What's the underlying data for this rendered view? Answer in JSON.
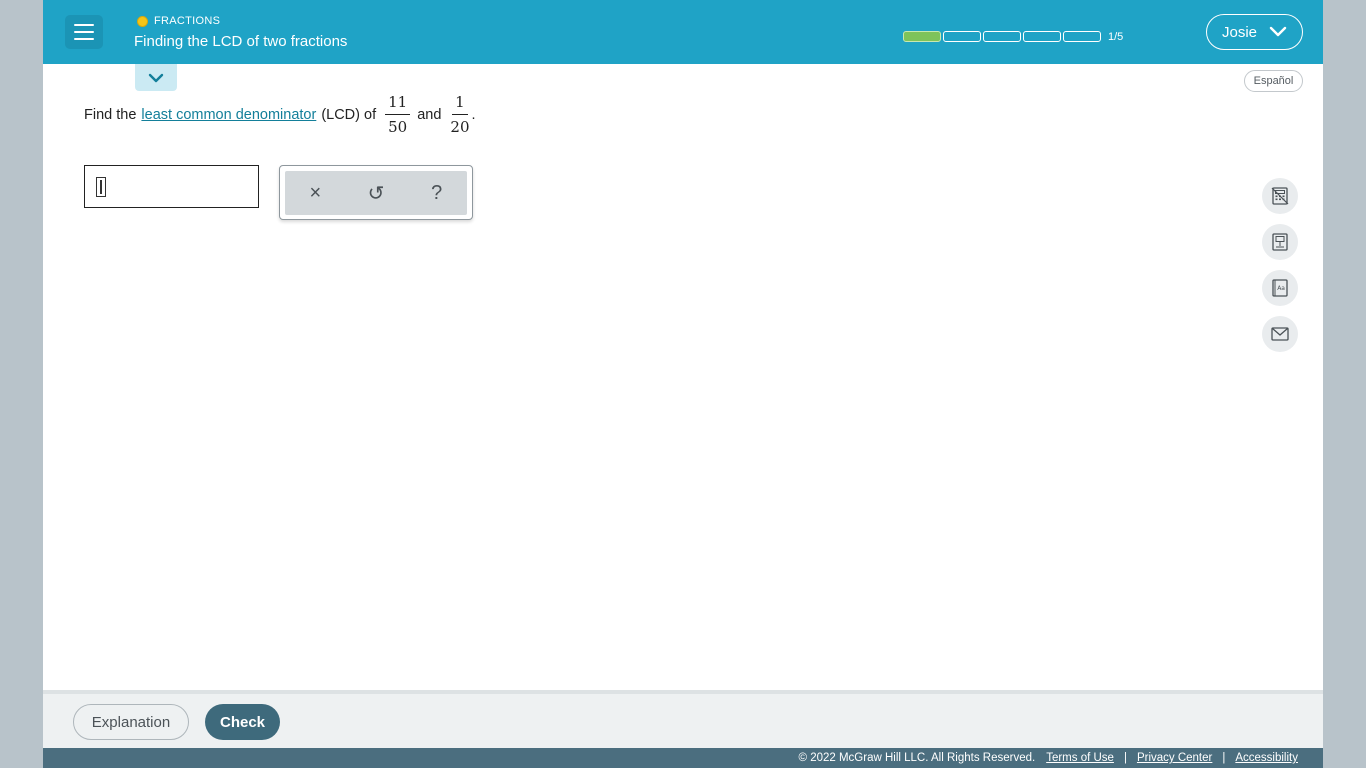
{
  "header": {
    "topic": "FRACTIONS",
    "title": "Finding the LCD of two fractions",
    "progress": {
      "current": 1,
      "total": 5,
      "label": "1/5"
    },
    "user_name": "Josie",
    "menu_icon": "hamburger-icon",
    "user_icon": "chevron-down-icon"
  },
  "language_button": "Español",
  "question": {
    "prefix": "Find the",
    "link_text": "least common denominator",
    "middle": "(LCD) of",
    "fraction1": {
      "numerator": "11",
      "denominator": "50"
    },
    "conjunction": "and",
    "fraction2": {
      "numerator": "1",
      "denominator": "20"
    },
    "suffix": "."
  },
  "answer": {
    "value": "",
    "tools": [
      "×",
      "↺",
      "?"
    ]
  },
  "side_tools": [
    "calculator-icon",
    "textbook-icon",
    "dictionary-icon",
    "message-icon"
  ],
  "bottom": {
    "explanation_label": "Explanation",
    "check_label": "Check"
  },
  "footer": {
    "copyright": "© 2022 McGraw Hill LLC. All Rights Reserved.",
    "terms": "Terms of Use",
    "privacy": "Privacy Center",
    "accessibility": "Accessibility"
  },
  "colors": {
    "header": "#1fa3c6",
    "progress_fill": "#7ec35a",
    "check_button": "#3e6a7c",
    "footer": "#4b6e7f",
    "link": "#137f9a"
  }
}
